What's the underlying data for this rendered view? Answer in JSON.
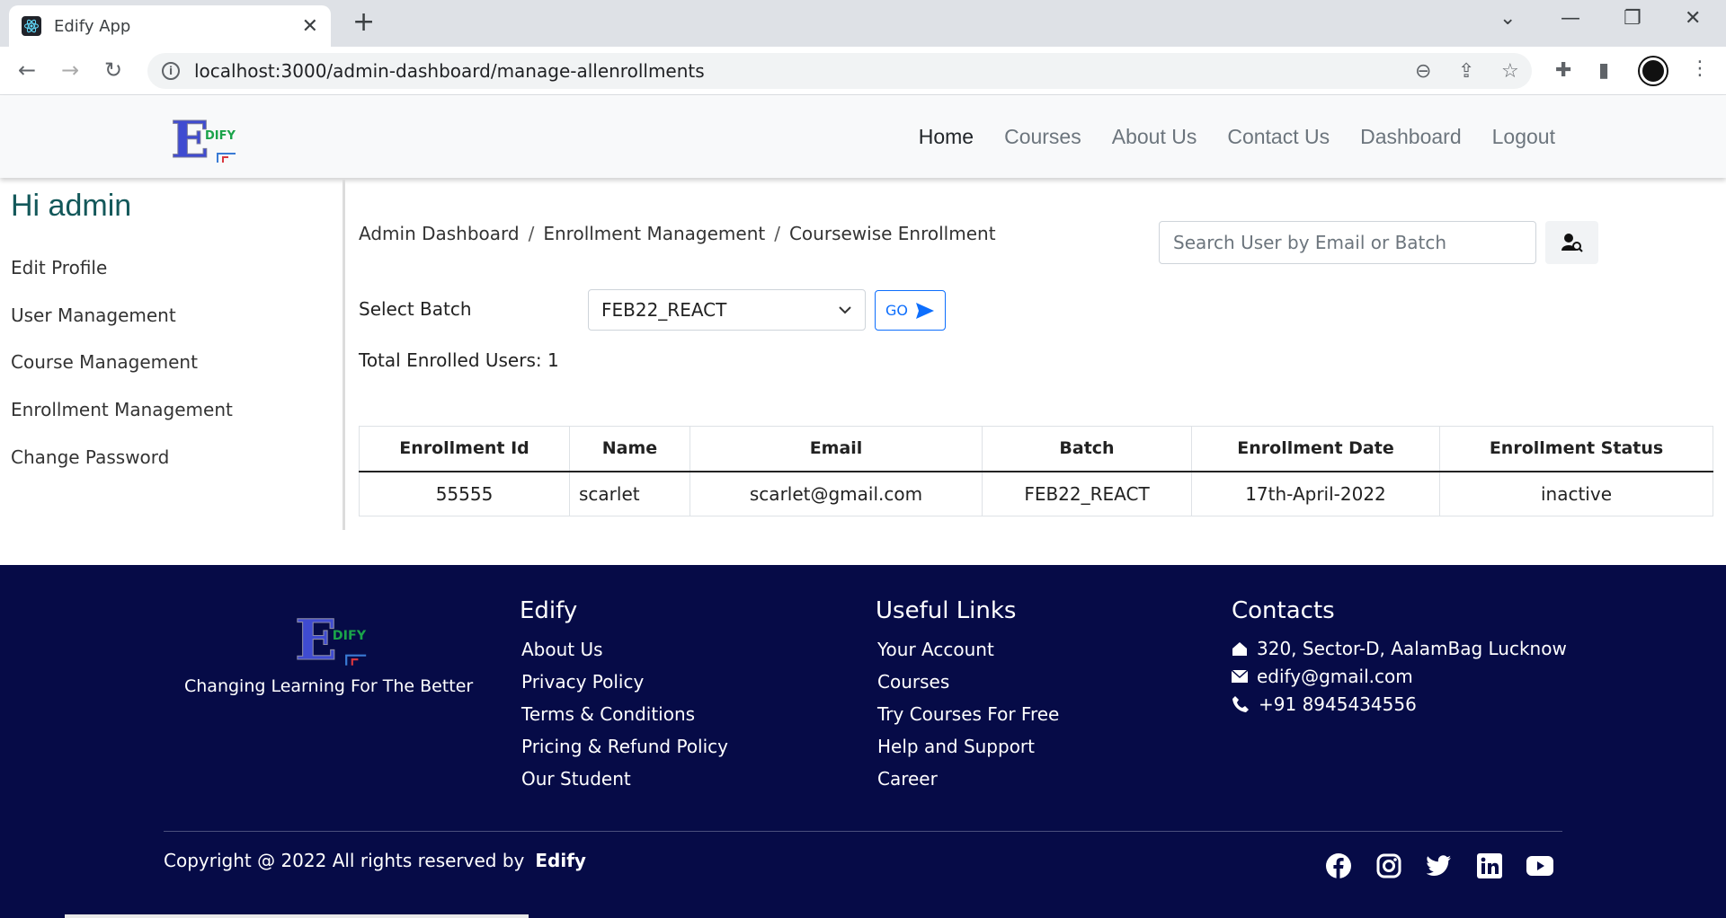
{
  "browser": {
    "tab_title": "Edify App",
    "url": "localhost:3000/admin-dashboard/manage-allenrollments"
  },
  "header": {
    "logo_text": "DIFY",
    "nav": [
      "Home",
      "Courses",
      "About Us",
      "Contact Us",
      "Dashboard",
      "Logout"
    ],
    "active": "Home"
  },
  "sidebar": {
    "greeting": "Hi admin",
    "items": [
      "Edit Profile",
      "User Management",
      "Course Management",
      "Enrollment Management",
      "Change Password"
    ]
  },
  "breadcrumb": [
    "Admin Dashboard",
    "Enrollment Management",
    "Coursewise Enrollment"
  ],
  "search": {
    "placeholder": "Search User by Email or Batch"
  },
  "batch": {
    "label": "Select Batch",
    "selected": "FEB22_REACT",
    "go_label": "GO",
    "total_label": "Total Enrolled Users: 1"
  },
  "table": {
    "headers": [
      "Enrollment Id",
      "Name",
      "Email",
      "Batch",
      "Enrollment Date",
      "Enrollment Status"
    ],
    "rows": [
      [
        "55555",
        "scarlet",
        "scarlet@gmail.com",
        "FEB22_REACT",
        "17th-April-2022",
        "inactive"
      ]
    ]
  },
  "footer": {
    "tagline": "Changing Learning For The Better",
    "edify": {
      "title": "Edify",
      "links": [
        "About Us",
        "Privacy Policy",
        "Terms & Conditions",
        "Pricing & Refund Policy",
        "Our Student"
      ]
    },
    "useful": {
      "title": "Useful Links",
      "links": [
        "Your Account",
        "Courses",
        "Try Courses For Free",
        "Help and Support",
        "Career"
      ]
    },
    "contacts": {
      "title": "Contacts",
      "address": "320, Sector-D, AalamBag Lucknow",
      "email": "edify@gmail.com",
      "phone": "+91 8945434556"
    },
    "copyright": "Copyright @ 2022 All rights reserved by",
    "brand": "Edify",
    "social": [
      "facebook-icon",
      "instagram-icon",
      "twitter-icon",
      "linkedin-icon",
      "youtube-icon"
    ]
  },
  "colors": {
    "footer_bg": "#060b47",
    "greeting": "#13585a",
    "accent": "#0d6efd"
  }
}
